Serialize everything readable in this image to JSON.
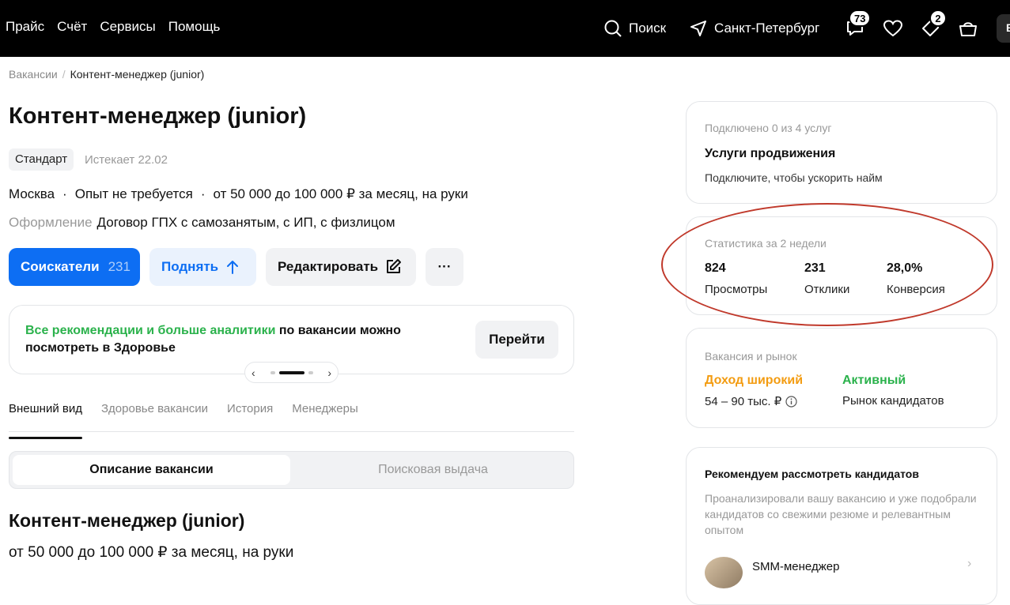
{
  "topnav": {
    "items": [
      "Прайс",
      "Счёт",
      "Сервисы",
      "Помощь"
    ],
    "search": "Поиск",
    "city": "Санкт-Петербург",
    "messages_count": "73",
    "favorites_count": "2",
    "corner": "Е"
  },
  "breadcrumb": {
    "root": "Вакансии",
    "current": "Контент-менеджер (junior)"
  },
  "vacancy": {
    "title": "Контент-менеджер (junior)",
    "tag": "Стандарт",
    "expires": "Истекает 22.02",
    "city": "Москва",
    "experience": "Опыт не требуется",
    "salary": "от 50 000 до 100 000 ₽ за месяц, на руки",
    "form_label": "Оформление",
    "form_value": "Договор ГПХ с самозанятым, с ИП, с физлицом"
  },
  "actions": {
    "candidates": "Соискатели",
    "candidates_count": "231",
    "raise": "Поднять",
    "edit": "Редактировать",
    "more": "···"
  },
  "promo": {
    "green": "Все рекомендации и больше аналитики",
    "rest": " по вакансии можно посмотреть в Здоровье",
    "button": "Перейти"
  },
  "tabs": [
    "Внешний вид",
    "Здоровье вакансии",
    "История",
    "Менеджеры"
  ],
  "segment": {
    "active": "Описание вакансии",
    "inactive": "Поисковая выдача"
  },
  "preview": {
    "title": "Контент-менеджер (junior)",
    "salary": "от 50 000 до 100 000 ₽ за месяц, на руки"
  },
  "promotion": {
    "subtitle": "Подключено 0 из 4 услуг",
    "title": "Услуги продвижения",
    "desc": "Подключите, чтобы ускорить найм"
  },
  "stats": {
    "title": "Статистика за 2 недели",
    "items": [
      {
        "value": "824",
        "label": "Просмотры"
      },
      {
        "value": "231",
        "label": "Отклики"
      },
      {
        "value": "28,0%",
        "label": "Конверсия"
      }
    ]
  },
  "market": {
    "title": "Вакансия и рынок",
    "income_label": "Доход широкий",
    "income_value": "54 – 90 тыс. ₽",
    "activity_label": "Активный",
    "activity_value": "Рынок кандидатов",
    "colors": {
      "income": "#f39c12",
      "activity": "#2bb24c"
    }
  },
  "recommend": {
    "title": "Рекомендуем рассмотреть кандидатов",
    "desc": "Проанализировали вашу вакансию и уже подобрали кандидатов со свежими резюме и релевантным опытом",
    "role": "SMM-менеджер"
  },
  "colors": {
    "accent": "#0d6ef3",
    "green": "#2bb24c",
    "annotation": "#c0392b"
  }
}
